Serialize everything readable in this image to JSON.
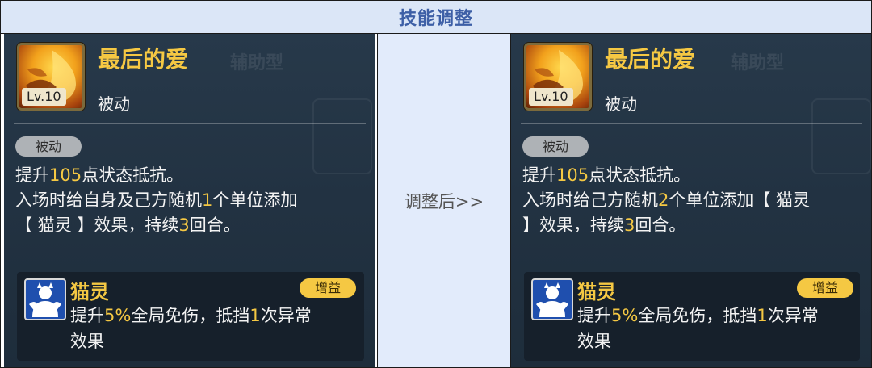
{
  "header": {
    "title": "技能调整"
  },
  "middle": {
    "label": "调整后>>"
  },
  "background_text": {
    "label": "辅助型"
  },
  "before": {
    "skill_name": "最后的爱",
    "level_badge": "Lv.10",
    "skill_type": "被动",
    "tag": "被动",
    "desc": {
      "l1_a": "提升",
      "l1_b": "105",
      "l1_c": "点状态抵抗。",
      "l2_a": "入场时给自身及己方随机",
      "l2_b": "1",
      "l2_c": "个单位添加",
      "l3_a": "【 猫灵 】效果，持续",
      "l3_b": "3",
      "l3_c": "回合。"
    },
    "buff": {
      "name": "猫灵",
      "badge": "增益",
      "d1_a": "提升",
      "d1_b": "5%",
      "d1_c": "全局免伤，抵挡",
      "d1_d": "1",
      "d1_e": "次异常",
      "d2": "效果"
    }
  },
  "after": {
    "skill_name": "最后的爱",
    "level_badge": "Lv.10",
    "skill_type": "被动",
    "tag": "被动",
    "desc": {
      "l1_a": "提升",
      "l1_b": "105",
      "l1_c": "点状态抵抗。",
      "l2_a": "入场时给己方随机",
      "l2_b": "2",
      "l2_c": "个单位添加【 猫灵",
      "l3_a": "】效果，持续",
      "l3_b": "3",
      "l3_c": "回合。"
    },
    "buff": {
      "name": "猫灵",
      "badge": "增益",
      "d1_a": "提升",
      "d1_b": "5%",
      "d1_c": "全局免伤，抵挡",
      "d1_d": "1",
      "d1_e": "次异常",
      "d2": "效果"
    }
  },
  "colors": {
    "highlight": "#f5c843",
    "header_bg": "#dbe6f7",
    "header_text": "#3d5fa6",
    "panel_bg": "#223242"
  },
  "icons": {
    "skill": "flame-fist-icon",
    "buff": "cat-spirit-icon"
  }
}
